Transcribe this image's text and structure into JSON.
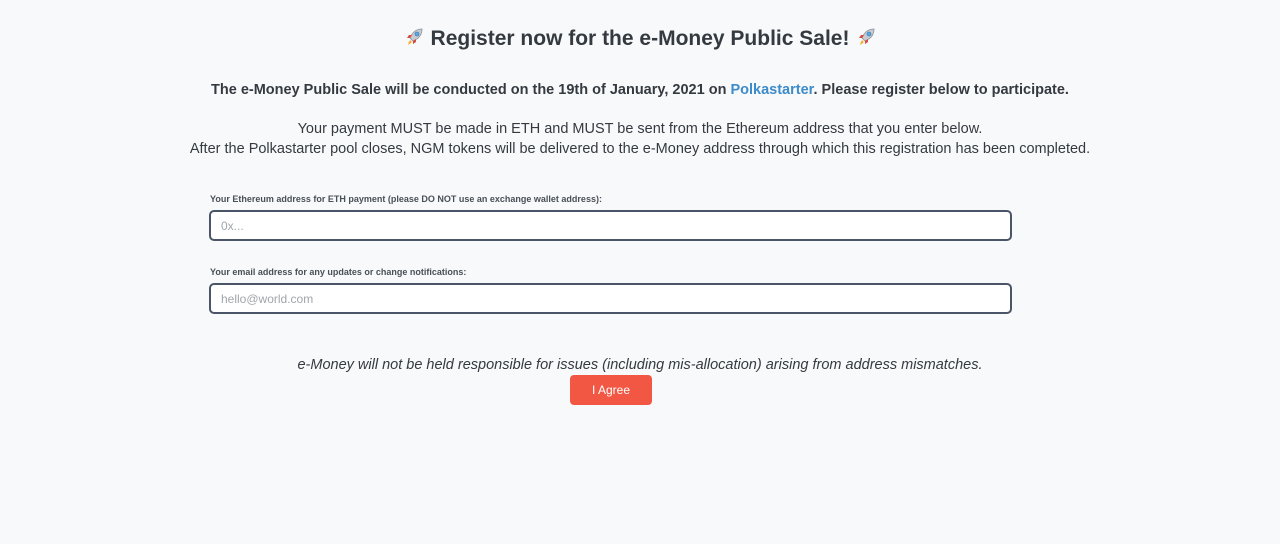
{
  "header": {
    "title": "Register now for the e-Money Public Sale!",
    "icon": "rocket-icon"
  },
  "announcement": {
    "prefix": "The e-Money Public Sale will be conducted on the 19th of January, 2021 on ",
    "link_text": "Polkastarter",
    "suffix": ". Please register below to participate."
  },
  "instructions": {
    "line1": "Your payment MUST be made in ETH and MUST be sent from the Ethereum address that you enter below.",
    "line2": "After the Polkastarter pool closes, NGM tokens will be delivered to the e-Money address through which this registration has been completed."
  },
  "form": {
    "eth_label": "Your Ethereum address for ETH payment (please DO NOT use an exchange wallet address):",
    "eth_placeholder": "0x...",
    "eth_value": "",
    "email_label": "Your email address for any updates or change notifications:",
    "email_placeholder": "hello@world.com",
    "email_value": ""
  },
  "disclaimer": "e-Money will not be held responsible for issues (including mis-allocation) arising from address mismatches.",
  "agree_button": "I Agree",
  "colors": {
    "link": "#3d8bc9",
    "button": "#f25744",
    "background": "#f8f9fa"
  }
}
